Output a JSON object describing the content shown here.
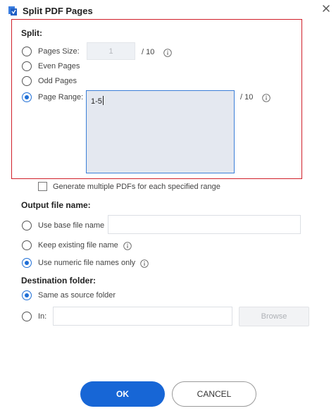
{
  "dialog": {
    "title": "Split PDF Pages",
    "close_icon": "close-icon",
    "app_icon": "pdf-app-icon"
  },
  "split": {
    "heading": "Split:",
    "pages_size": {
      "label": "Pages Size:",
      "value": "1",
      "total": "/ 10",
      "checked": false
    },
    "even_pages": {
      "label": "Even Pages",
      "checked": false
    },
    "odd_pages": {
      "label": "Odd Pages",
      "checked": false
    },
    "page_range": {
      "label": "Page Range:",
      "value": "1-5",
      "total": "/ 10",
      "checked": true
    },
    "generate_multiple": {
      "label": "Generate multiple PDFs for each specified range",
      "checked": false
    }
  },
  "output": {
    "heading": "Output file name:",
    "use_base": {
      "label": "Use base file name",
      "value": "",
      "checked": false
    },
    "keep_existing": {
      "label": "Keep existing file name",
      "checked": false
    },
    "use_numeric": {
      "label": "Use numeric file names only",
      "checked": true
    }
  },
  "destination": {
    "heading": "Destination folder:",
    "same_as_source": {
      "label": "Same as source folder",
      "checked": true
    },
    "in": {
      "label": "In:",
      "value": "",
      "checked": false
    },
    "browse_label": "Browse"
  },
  "buttons": {
    "ok": "OK",
    "cancel": "CANCEL"
  },
  "colors": {
    "accent": "#1766d6",
    "highlight_border": "#d0202a"
  }
}
